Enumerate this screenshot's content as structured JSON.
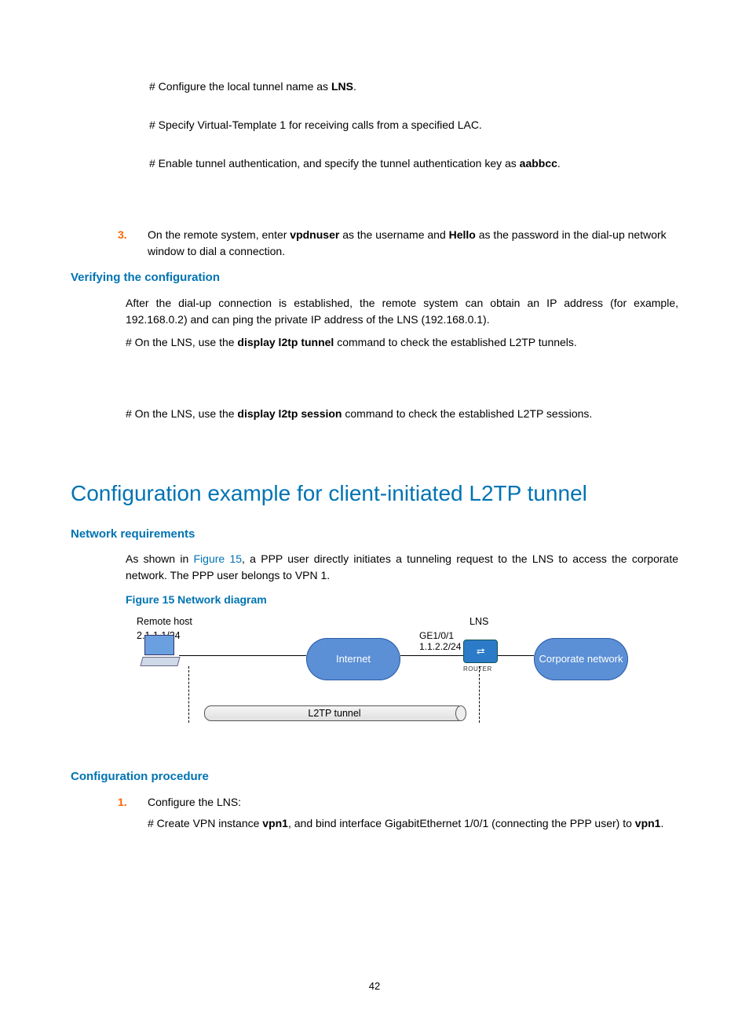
{
  "step_tunnel_name": {
    "prefix": "# Configure the local tunnel name as ",
    "bold": "LNS",
    "suffix": "."
  },
  "step_vt": "# Specify Virtual-Template 1 for receiving calls from a specified LAC.",
  "step_auth": {
    "prefix": "# Enable tunnel authentication, and specify the tunnel authentication key as ",
    "bold": "aabbcc",
    "suffix": "."
  },
  "step3": {
    "num": "3.",
    "t1": "On the remote system, enter ",
    "b1": "vpdnuser",
    "t2": " as the username and ",
    "b2": "Hello",
    "t3": " as the password in the dial-up network window to dial a connection."
  },
  "verify": {
    "heading": "Verifying the configuration",
    "p1": "After the dial-up connection is established, the remote system can obtain an IP address (for example, 192.168.0.2) and can ping the private IP address of the LNS (192.168.0.1).",
    "p2a": "# On the LNS, use the ",
    "p2b": "display l2tp tunnel",
    "p2c": " command to check the established L2TP tunnels.",
    "p3a": "# On the LNS, use the ",
    "p3b": "display l2tp session",
    "p3c": " command to check the established L2TP sessions."
  },
  "main_heading": "Configuration example for client-initiated L2TP tunnel",
  "netreq": {
    "heading": "Network requirements",
    "t1": "As shown in ",
    "link": "Figure 15",
    "t2": ", a PPP user directly initiates a tunneling request to the LNS to access the corporate network. The PPP user belongs to VPN 1."
  },
  "figure_caption": "Figure 15 Network diagram",
  "diagram": {
    "remote_host": "Remote host",
    "host_ip": "2.1.1.1/24",
    "internet": "Internet",
    "ge": "GE1/0/1",
    "ge_ip": "1.1.2.2/24",
    "lns": "LNS",
    "router": "ROUTER",
    "corp": "Corporate network",
    "tunnel": "L2TP tunnel"
  },
  "cfgproc": {
    "heading": "Configuration procedure",
    "num": "1.",
    "step1": "Configure the LNS:",
    "p_a": "# Create VPN instance ",
    "p_b1": "vpn1",
    "p_c": ", and bind interface GigabitEthernet 1/0/1 (connecting the PPP user) to ",
    "p_b2": "vpn1",
    "p_d": "."
  },
  "page_number": "42"
}
